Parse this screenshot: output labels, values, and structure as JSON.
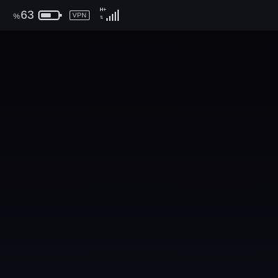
{
  "status_bar": {
    "battery": {
      "percent_symbol": "%",
      "value": "63",
      "level": 0.63
    },
    "vpn_label": "VPN",
    "network": {
      "type": "H+",
      "arrows": "⇅",
      "signal_bars": 5
    }
  },
  "colors": {
    "status_bar_bg": "#101217",
    "screen_bg": "#07070d",
    "icon": "#d0d0d6"
  },
  "icons": [
    "battery-icon",
    "vpn-icon",
    "data-activity-icon",
    "cellular-signal-icon"
  ]
}
